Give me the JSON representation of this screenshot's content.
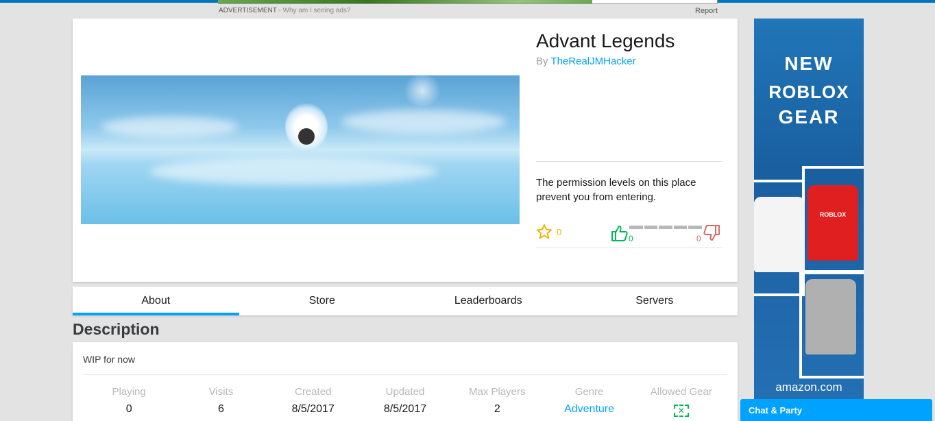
{
  "ad_top": {
    "caption": "ADVERTISEMENT",
    "why": " - Why am I seeing ads?",
    "report": "Report"
  },
  "game": {
    "title": "Advant Legends",
    "by_prefix": "By",
    "creator": "TheRealJMHacker",
    "permission_message": "The permission levels on this place prevent you from entering.",
    "favorites": "0",
    "upvotes": "0",
    "downvotes": "0"
  },
  "tabs": [
    {
      "label": "About",
      "active": true
    },
    {
      "label": "Store"
    },
    {
      "label": "Leaderboards"
    },
    {
      "label": "Servers"
    }
  ],
  "description": {
    "heading": "Description",
    "text": "WIP for now"
  },
  "stats": [
    {
      "label": "Playing",
      "value": "0"
    },
    {
      "label": "Visits",
      "value": "6"
    },
    {
      "label": "Created",
      "value": "8/5/2017"
    },
    {
      "label": "Updated",
      "value": "8/5/2017"
    },
    {
      "label": "Max Players",
      "value": "2"
    },
    {
      "label": "Genre",
      "value": "Adventure"
    },
    {
      "label": "Allowed Gear",
      "icon": "gear-none-icon"
    }
  ],
  "side_ad": {
    "line1": "NEW",
    "line2": "ROBLOX",
    "line3": "GEAR",
    "shirt_label": "ROBLOX",
    "brand": "amazon.com"
  },
  "chat": {
    "label": "Chat & Party"
  },
  "colors": {
    "accent": "#00a2ff",
    "upvote": "#02b757",
    "downvote": "#d86868",
    "favorite": "#f5b200"
  }
}
